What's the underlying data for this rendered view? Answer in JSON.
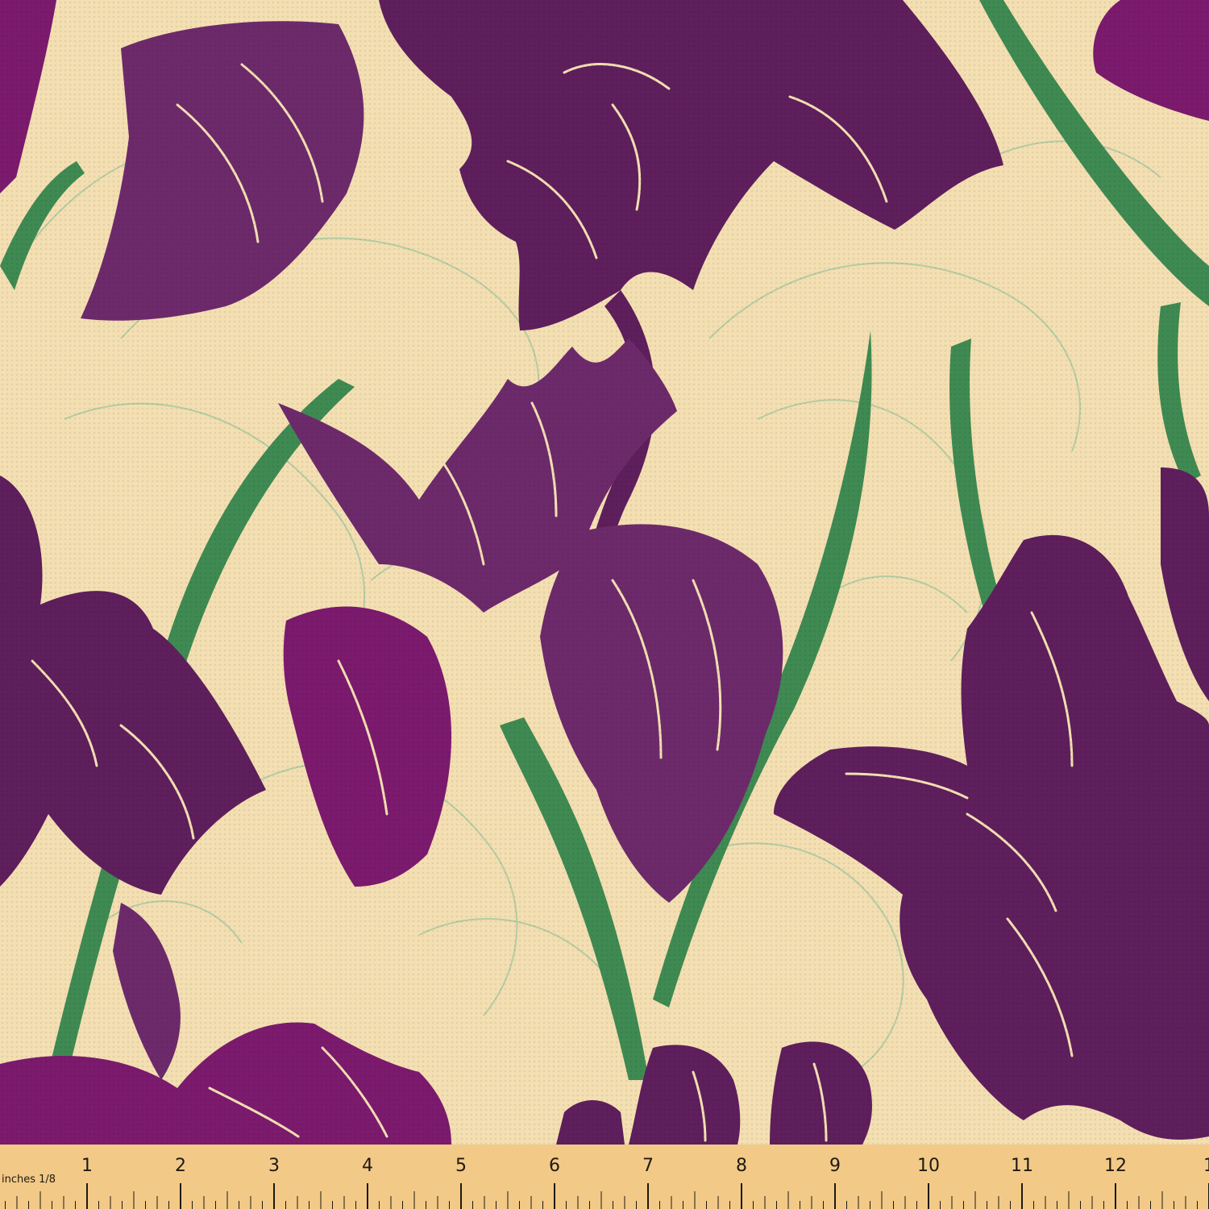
{
  "colors": {
    "background": "#f4dfb2",
    "purple_dark": "#5e1f5c",
    "purple_mid": "#6d2a6b",
    "magenta": "#7c1a6e",
    "leaf_green": "#3f8a52",
    "outline_green": "#a9c9a0",
    "ruler": "#f2c986",
    "ruler_mark": "#1e1a14"
  },
  "image": {
    "subject": "irises-on-cream-fabric"
  },
  "ruler": {
    "unit_label": "inches 1/8",
    "numbers": [
      "1",
      "2",
      "3",
      "4",
      "5",
      "6",
      "7",
      "8",
      "9",
      "10",
      "11",
      "12",
      "1"
    ]
  }
}
